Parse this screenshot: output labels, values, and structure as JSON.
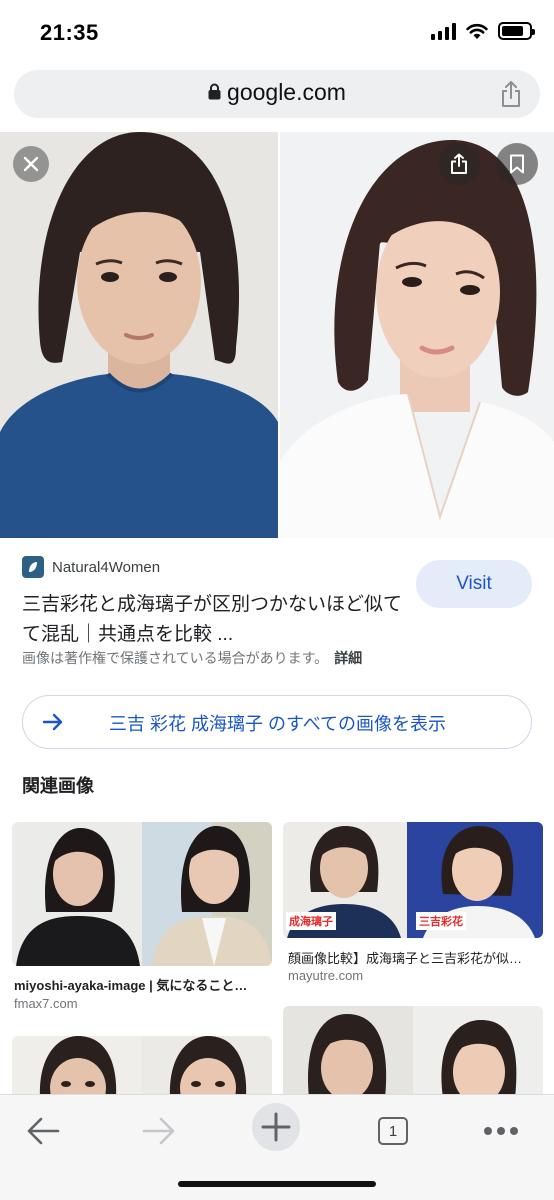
{
  "status_bar": {
    "time": "21:35"
  },
  "browser": {
    "url": "google.com"
  },
  "result": {
    "source_name": "Natural4Women",
    "title": "三吉彩花と成海璃子が区別つかないほど似てて混乱｜共通点を比較 ...",
    "visit_label": "Visit",
    "copyright_notice": "画像は著作権で保護されている場合があります。",
    "copyright_detail": "詳細"
  },
  "all_images": {
    "label": "三吉 彩花 成海璃子 のすべての画像を表示"
  },
  "related": {
    "heading": "関連画像",
    "cards": [
      {
        "caption": "miyoshi-ayaka-image | 気になること…",
        "domain": "fmax7.com"
      },
      {
        "caption": "顔画像比較】成海璃子と三吉彩花が似…",
        "domain": "mayutre.com",
        "tag_left": "成海璃子",
        "tag_right": "三吉彩花"
      }
    ]
  },
  "toolbar": {
    "tab_count": "1"
  },
  "colors": {
    "accent": "#1a56c8",
    "visit_bg": "#e4ecfa"
  }
}
